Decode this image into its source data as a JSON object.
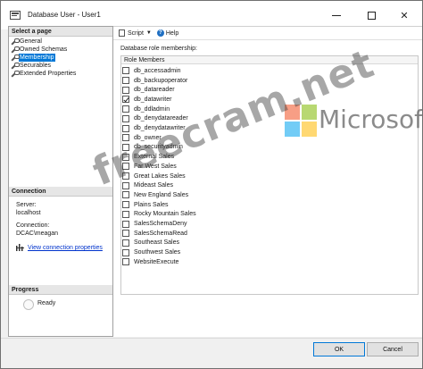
{
  "window": {
    "title": "Database User - User1"
  },
  "left": {
    "select_page_header": "Select a page",
    "pages": [
      {
        "label": "General",
        "selected": false
      },
      {
        "label": "Owned Schemas",
        "selected": false
      },
      {
        "label": "Membership",
        "selected": true
      },
      {
        "label": "Securables",
        "selected": false
      },
      {
        "label": "Extended Properties",
        "selected": false
      }
    ],
    "connection_header": "Connection",
    "server_label": "Server:",
    "server_value": "localhost",
    "connection_label": "Connection:",
    "connection_value": "DCAC\\meagan",
    "view_connection_link": "View connection properties",
    "progress_header": "Progress",
    "progress_status": "Ready"
  },
  "toolbar": {
    "script_label": "Script",
    "help_label": "Help"
  },
  "membership": {
    "section_label": "Database role membership:",
    "column_header": "Role Members",
    "roles": [
      {
        "name": "db_accessadmin",
        "checked": false
      },
      {
        "name": "db_backupoperator",
        "checked": false
      },
      {
        "name": "db_datareader",
        "checked": false
      },
      {
        "name": "db_datawriter",
        "checked": true
      },
      {
        "name": "db_ddladmin",
        "checked": false
      },
      {
        "name": "db_denydatareader",
        "checked": false
      },
      {
        "name": "db_denydatawriter",
        "checked": false
      },
      {
        "name": "db_owner",
        "checked": false
      },
      {
        "name": "db_securityadmin",
        "checked": false
      },
      {
        "name": "External Sales",
        "checked": false
      },
      {
        "name": "Far West Sales",
        "checked": false
      },
      {
        "name": "Great Lakes Sales",
        "checked": false
      },
      {
        "name": "Mideast Sales",
        "checked": false
      },
      {
        "name": "New England Sales",
        "checked": false
      },
      {
        "name": "Plains Sales",
        "checked": false
      },
      {
        "name": "Rocky Mountain Sales",
        "checked": false
      },
      {
        "name": "SalesSchemaDeny",
        "checked": false
      },
      {
        "name": "SalesSchemaRead",
        "checked": false
      },
      {
        "name": "Southeast Sales",
        "checked": false
      },
      {
        "name": "Southwest Sales",
        "checked": false
      },
      {
        "name": "WebsiteExecute",
        "checked": false
      }
    ]
  },
  "buttons": {
    "ok_label": "OK",
    "cancel_label": "Cancel"
  },
  "watermark": {
    "site_text": "freecram.net",
    "brand_text": "Microsoft"
  },
  "colors": {
    "selection": "#0078d7",
    "link": "#0033cc"
  }
}
